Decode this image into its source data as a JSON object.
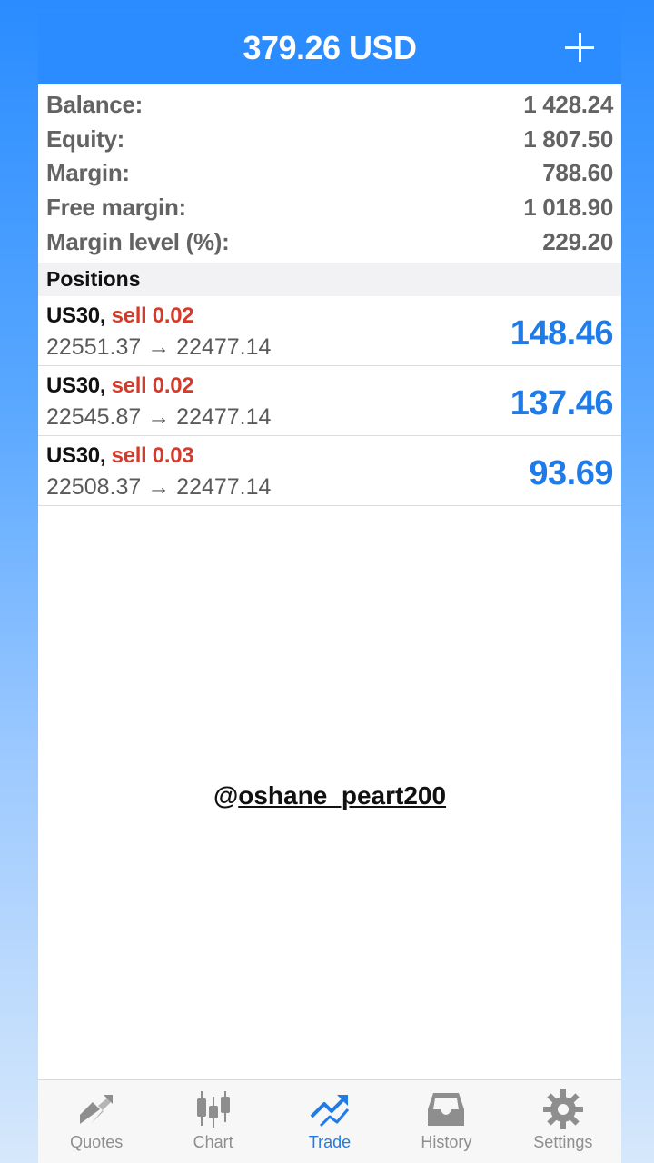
{
  "header": {
    "title": "379.26 USD",
    "add_icon": "plus-icon"
  },
  "summary": [
    {
      "label": "Balance:",
      "value": "1 428.24"
    },
    {
      "label": "Equity:",
      "value": "1 807.50"
    },
    {
      "label": "Margin:",
      "value": "788.60"
    },
    {
      "label": "Free margin:",
      "value": "1 018.90"
    },
    {
      "label": "Margin level (%):",
      "value": "229.20"
    }
  ],
  "positions_header": "Positions",
  "positions": [
    {
      "symbol": "US30,",
      "side": "sell 0.02",
      "prices": "22551.37 → 22477.14",
      "profit": "148.46"
    },
    {
      "symbol": "US30,",
      "side": "sell 0.02",
      "prices": "22545.87 → 22477.14",
      "profit": "137.46"
    },
    {
      "symbol": "US30,",
      "side": "sell 0.03",
      "prices": "22508.37 → 22477.14",
      "profit": "93.69"
    }
  ],
  "watermark": {
    "at": "@",
    "handle": "oshane_peart200"
  },
  "tabs": [
    {
      "label": "Quotes",
      "icon": "quotes-icon"
    },
    {
      "label": "Chart",
      "icon": "chart-icon"
    },
    {
      "label": "Trade",
      "icon": "trade-icon",
      "active": true
    },
    {
      "label": "History",
      "icon": "history-icon"
    },
    {
      "label": "Settings",
      "icon": "settings-icon"
    }
  ],
  "colors": {
    "accent": "#2a8cff",
    "profit": "#1f7be8",
    "sell": "#d63a2a"
  }
}
